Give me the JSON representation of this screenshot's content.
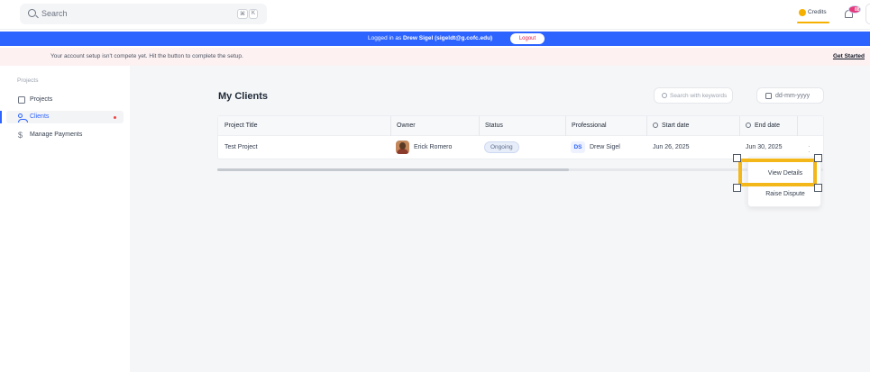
{
  "topbar": {
    "search_placeholder": "Search",
    "shortcut_keys": [
      "⌘",
      "K"
    ],
    "credits_label": "Credits",
    "notification_count": "88"
  },
  "banner": {
    "prefix": "Logged in as",
    "user": "Drew Sigel (sigeldt@g.cofc.edu)",
    "logout_label": "Logout"
  },
  "warning": {
    "message": "Your account setup isn't compete yet. Hit the button to complete the setup.",
    "cta": "Get Started"
  },
  "sidebar": {
    "section": "Projects",
    "items": [
      {
        "label": "Projects",
        "icon": "document-icon"
      },
      {
        "label": "Clients",
        "icon": "users-icon"
      },
      {
        "label": "Manage Payments",
        "icon": "dollar-icon"
      }
    ]
  },
  "main": {
    "title": "My Clients",
    "keyword_placeholder": "Search with keywords",
    "date_placeholder": "dd-mm-yyyy",
    "columns": [
      "Project Title",
      "Owner",
      "Status",
      "Professional",
      "Start date",
      "End date"
    ],
    "rows": [
      {
        "project_title": "Test Project",
        "owner": "Erick Romero",
        "status": "Ongoing",
        "professional_initials": "DS",
        "professional": "Drew Sigel",
        "start_date": "Jun 26, 2025",
        "end_date": "Jun 30, 2025"
      }
    ],
    "menu": [
      "View Details",
      "Raise Dispute"
    ]
  },
  "colors": {
    "accent": "#2d63ff",
    "highlight": "#f3b71a",
    "warning_bg": "#fdf1f2"
  }
}
